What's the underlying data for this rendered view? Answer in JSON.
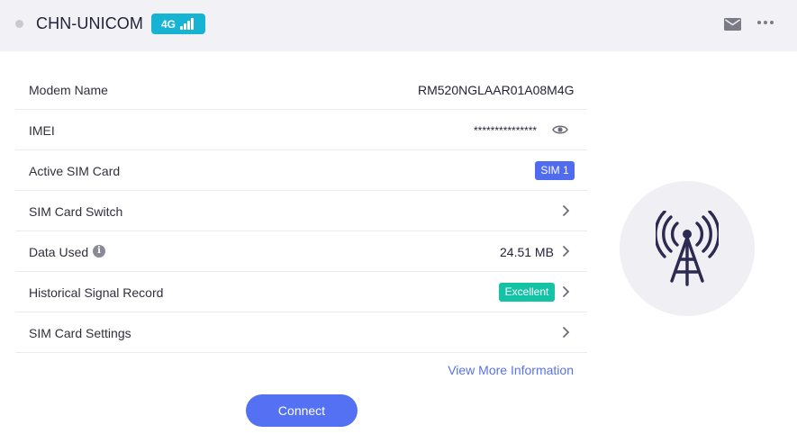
{
  "header": {
    "carrier": "CHN-UNICOM",
    "network_type": "4G",
    "icons": [
      "status-dot",
      "signal-bars-icon",
      "mail-icon",
      "more-icon"
    ]
  },
  "info": {
    "rows": [
      {
        "label": "Modem Name",
        "value": "RM520NGLAAR01A08M4G"
      },
      {
        "label": "IMEI",
        "value": "***************",
        "icon": "eye-icon"
      },
      {
        "label": "Active SIM Card",
        "value": "SIM 1"
      },
      {
        "label": "SIM Card Switch",
        "icon": "chevron-right-icon"
      },
      {
        "label": "Data Used",
        "value": "24.51 MB",
        "icon": "chevron-right-icon"
      },
      {
        "label": "Historical Signal Record",
        "value": "Excellent",
        "icon": "chevron-right-icon"
      },
      {
        "label": "SIM Card Settings",
        "icon": "chevron-right-icon"
      }
    ],
    "more_link": "View More Information"
  },
  "actions": {
    "connect_label": "Connect"
  },
  "illustration": {
    "icon": "cell-tower-icon"
  },
  "colors": {
    "header_bg": "#f2f2f6",
    "network_badge": "#16b4d2",
    "sim_badge": "#4f6cf0",
    "signal_badge": "#14c3a5",
    "primary": "#5470f3",
    "tower": "#2d2a52"
  }
}
